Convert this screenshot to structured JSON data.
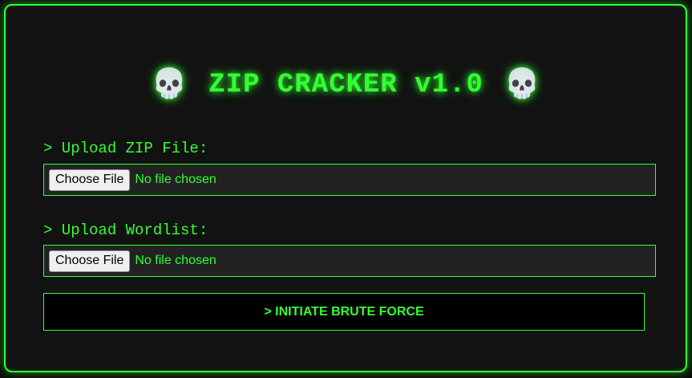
{
  "header": {
    "title": "ZIP CRACKER v1.0",
    "left_icon": "💀",
    "right_icon": "💀"
  },
  "zip_upload": {
    "label": "> Upload ZIP File:",
    "button_label": "Choose File",
    "status": "No file chosen"
  },
  "wordlist_upload": {
    "label": "> Upload Wordlist:",
    "button_label": "Choose File",
    "status": "No file chosen"
  },
  "action": {
    "label": "> INITIATE BRUTE FORCE"
  },
  "theme": {
    "accent": "#33ff33",
    "background": "#121212",
    "input_background": "#222222"
  }
}
